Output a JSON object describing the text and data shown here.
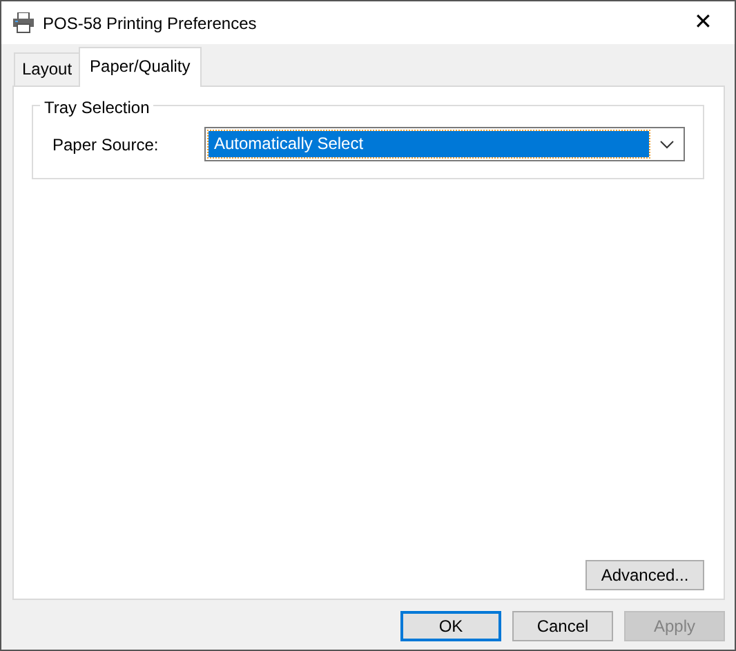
{
  "window": {
    "title": "POS-58 Printing Preferences",
    "close": "✕"
  },
  "tabs": [
    {
      "label": "Layout",
      "selected": false
    },
    {
      "label": "Paper/Quality",
      "selected": true
    }
  ],
  "group": {
    "title": "Tray Selection",
    "fields": [
      {
        "label": "Paper Source:",
        "value": "Automatically Select",
        "focused": true
      }
    ]
  },
  "advanced_button": "Advanced...",
  "buttons": [
    {
      "label": "OK",
      "default": true,
      "disabled": false
    },
    {
      "label": "Cancel",
      "default": false,
      "disabled": false
    },
    {
      "label": "Apply",
      "default": false,
      "disabled": true
    }
  ]
}
